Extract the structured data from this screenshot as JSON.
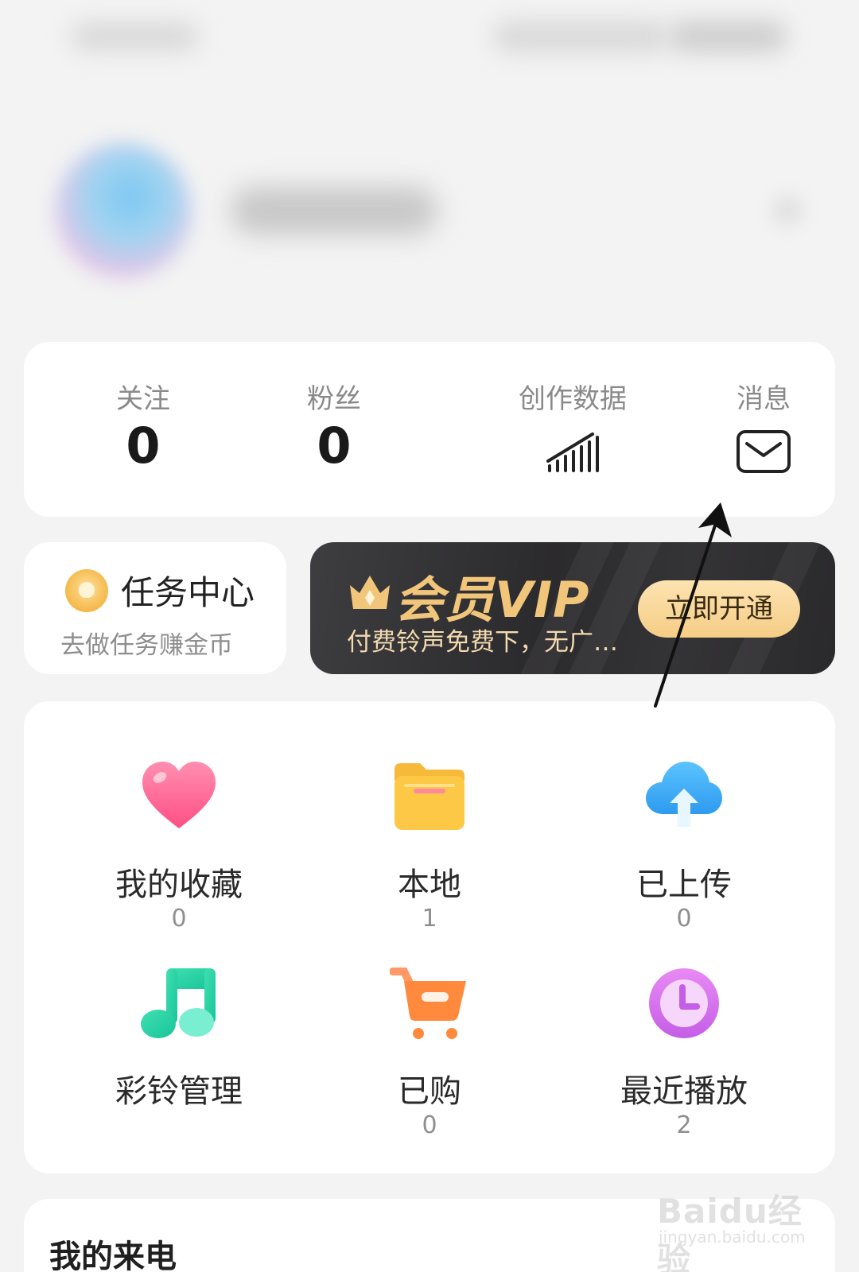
{
  "stats": {
    "follow_label": "关注",
    "follow_value": "0",
    "fans_label": "粉丝",
    "fans_value": "0",
    "creation_label": "创作数据",
    "message_label": "消息"
  },
  "task": {
    "title": "任务中心",
    "subtitle": "去做任务赚金币"
  },
  "vip": {
    "title": "会员VIP",
    "subtitle": "付费铃声免费下，无广…",
    "button": "立即开通",
    "accent": "#f2c67a"
  },
  "grid": [
    {
      "label": "我的收藏",
      "count": "0",
      "icon": "heart-icon"
    },
    {
      "label": "本地",
      "count": "1",
      "icon": "folder-icon"
    },
    {
      "label": "已上传",
      "count": "0",
      "icon": "cloud-upload-icon"
    },
    {
      "label": "彩铃管理",
      "count": "",
      "icon": "music-note-icon"
    },
    {
      "label": "已购",
      "count": "0",
      "icon": "shopping-cart-icon"
    },
    {
      "label": "最近播放",
      "count": "2",
      "icon": "clock-icon"
    }
  ],
  "calls": {
    "title": "我的来电"
  },
  "watermark": {
    "main": "Baidu经验",
    "sub": "jingyan.baidu.com"
  }
}
